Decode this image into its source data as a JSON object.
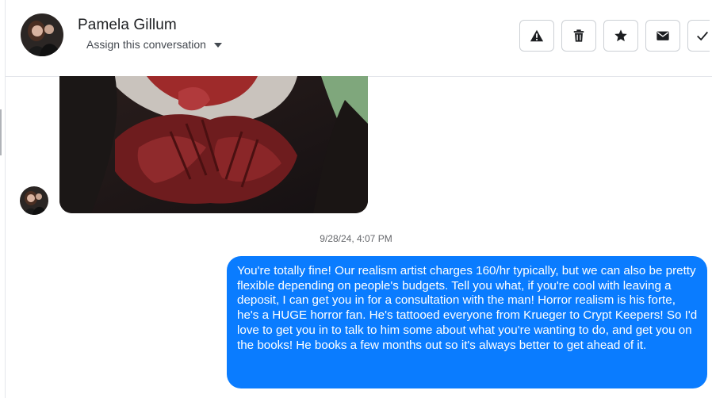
{
  "header": {
    "contact_name": "Pamela Gillum",
    "assign_label": "Assign this conversation",
    "avatar_icon": "profile-photo"
  },
  "actions": [
    {
      "icon": "warning-icon",
      "label": "Mark as spam"
    },
    {
      "icon": "trash-icon",
      "label": "Delete"
    },
    {
      "icon": "star-icon",
      "label": "Follow up"
    },
    {
      "icon": "envelope-icon",
      "label": "Mark as unread"
    },
    {
      "icon": "check-icon",
      "label": "Move to done"
    }
  ],
  "conversation": {
    "image_description_icon": "photo-attachment",
    "timestamp": "9/28/24, 4:07 PM",
    "outgoing_message": "You're totally fine! Our realism artist charges 160/hr typically, but we can also be pretty flexible depending on people's budgets. Tell you what, if you're cool with leaving a deposit, I can get you in for a consultation with the man! Horror realism is his forte, he's a HUGE horror fan. He's tattooed everyone from Krueger to Crypt Keepers! So I'd love to get you in to talk to him some about what you're wanting to do, and get you on the books! He books a few months out so it's always better to get ahead of it."
  },
  "colors": {
    "bubble": "#0a7cff",
    "border": "#ccd0d5",
    "muted_text": "#65676b"
  }
}
